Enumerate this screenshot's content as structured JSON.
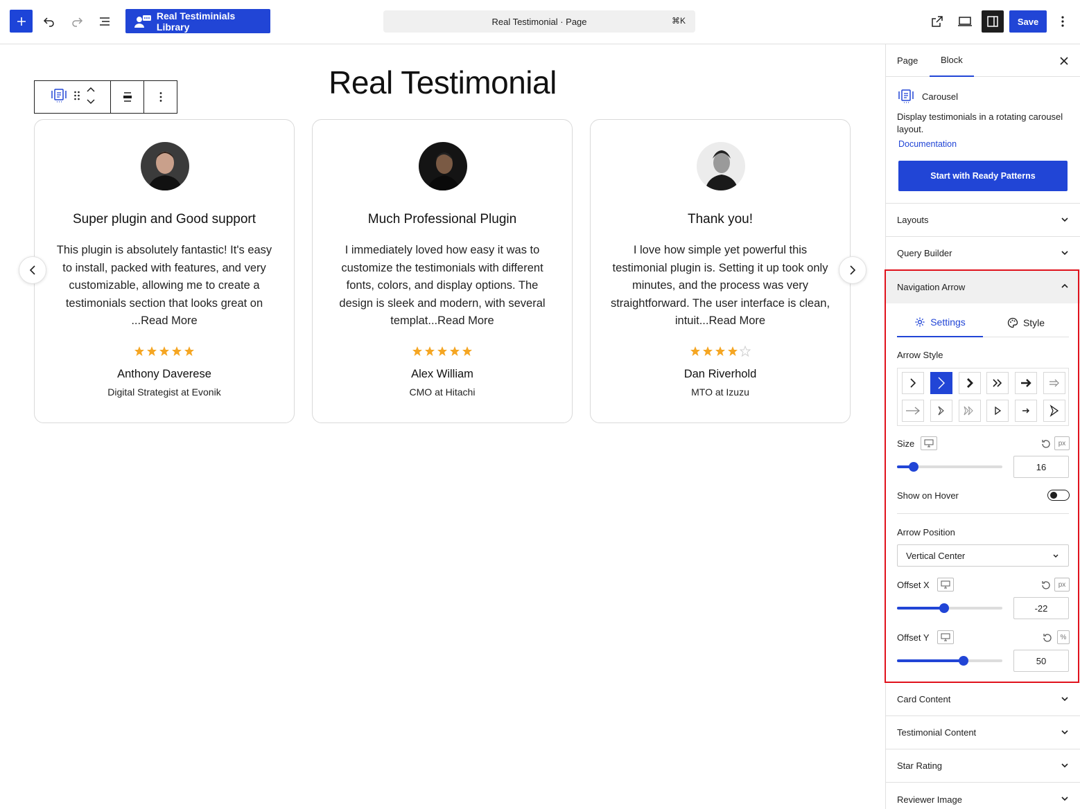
{
  "topbar": {
    "library_button": "Real Testiminials Library",
    "document_title": "Real Testimonial · Page",
    "shortcut": "⌘K",
    "save_label": "Save"
  },
  "canvas": {
    "page_title": "Real Testimonial",
    "testimonials": [
      {
        "title": "Super plugin and Good support",
        "text": "This plugin is absolutely fantastic! It's easy to install, packed with features, and very customizable, allowing me to create a testimonials section that looks great on ...Read More",
        "rating": 5,
        "name": "Anthony Daverese",
        "role": "Digital Strategist at Evonik"
      },
      {
        "title": "Much Professional Plugin",
        "text": "I immediately loved how easy it was to customize the testimonials with different fonts, colors, and display options. The design is sleek and modern, with several templat...Read More",
        "rating": 5,
        "name": "Alex William",
        "role": "CMO at Hitachi"
      },
      {
        "title": "Thank you!",
        "text": "I love how simple yet powerful this testimonial plugin is. Setting it up took only minutes, and the process was very straightforward. The user interface is clean, intuit...Read More",
        "rating": 4,
        "name": "Dan Riverhold",
        "role": "MTO at Izuzu"
      }
    ]
  },
  "sidebar": {
    "tabs": {
      "page": "Page",
      "block": "Block"
    },
    "block": {
      "name": "Carousel",
      "description": "Display testimonials in a rotating carousel layout.",
      "doc_link": "Documentation",
      "patterns_button": "Start with Ready Patterns"
    },
    "panels": {
      "layouts": "Layouts",
      "query_builder": "Query Builder",
      "navigation_arrow": "Navigation Arrow",
      "card_content": "Card Content",
      "testimonial_content": "Testimonial Content",
      "star_rating": "Star Rating",
      "reviewer_image": "Reviewer Image"
    },
    "nav_arrow": {
      "tab_settings": "Settings",
      "tab_style": "Style",
      "arrow_style_label": "Arrow Style",
      "size_label": "Size",
      "size_unit": "px",
      "size_value": "16",
      "size_level": 0.16,
      "show_on_hover_label": "Show on Hover",
      "show_on_hover": false,
      "arrow_position_label": "Arrow Position",
      "arrow_position_value": "Vertical Center",
      "offset_x_label": "Offset X",
      "offset_x_unit": "px",
      "offset_x_value": "-22",
      "offset_x_level": 0.45,
      "offset_y_label": "Offset Y",
      "offset_y_unit": "%",
      "offset_y_value": "50",
      "offset_y_level": 0.63
    }
  },
  "colors": {
    "accent": "#2145d6",
    "star": "#f5a623",
    "highlight_frame": "#e0111b"
  }
}
